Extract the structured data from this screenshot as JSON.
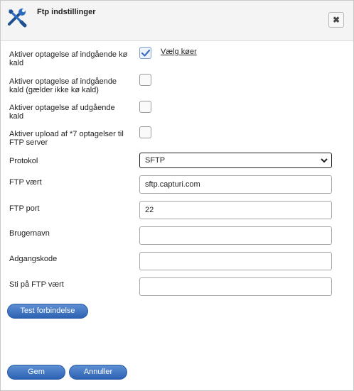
{
  "dialog": {
    "title": "Ftp indstillinger",
    "icon": "tools-icon",
    "close_icon": "close-icon"
  },
  "options": [
    {
      "label": "Aktiver optagelse af indgående kø kald",
      "checked": true,
      "link": "Vælg køer"
    },
    {
      "label": "Aktiver optagelse af indgående kald (gælder ikke kø kald)",
      "checked": false
    },
    {
      "label": "Aktiver optagelse af udgående kald",
      "checked": false
    },
    {
      "label": "Aktiver upload af *7 optagelser til FTP server",
      "checked": false
    }
  ],
  "fields": {
    "protocol": {
      "label": "Protokol",
      "value": "SFTP"
    },
    "host": {
      "label": "FTP vært",
      "value": "sftp.capturi.com"
    },
    "port": {
      "label": "FTP port",
      "value": "22"
    },
    "username": {
      "label": "Brugernavn",
      "value": ""
    },
    "password": {
      "label": "Adgangskode",
      "value": ""
    },
    "path": {
      "label": "Sti på FTP vært",
      "value": ""
    }
  },
  "buttons": {
    "test": "Test forbindelse",
    "save": "Gem",
    "cancel": "Annuller"
  },
  "colors": {
    "button": "#3a6fc0",
    "header_bg": "#f4f4f4",
    "check": "#3a6fc0"
  }
}
